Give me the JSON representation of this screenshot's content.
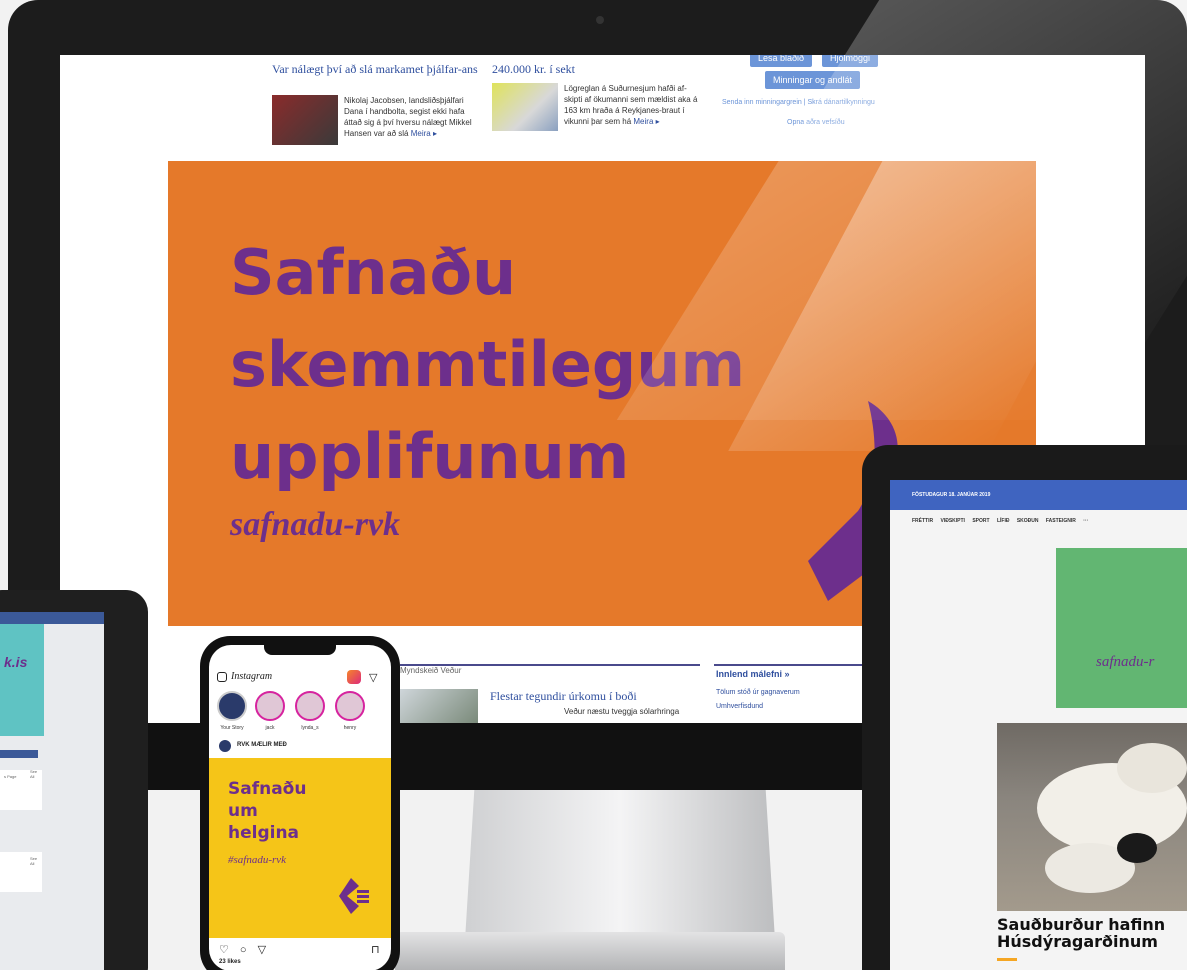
{
  "monitor": {
    "news_left": {
      "headline": "Var nálægt því að slá markamet þjálfar-ans",
      "text": "Nikolaj Jacobsen, landsliðsþjálfari Dana í handbolta, segist ekki hafa áttað sig á því hversu nálægt Mikkel Hansen var að slá",
      "more": "Meira ▸"
    },
    "news_mid": {
      "headline": "240.000 kr. í sekt",
      "text": "Lögreglan á Suðurnesjum hafði af-skipti af ökumanni sem mældist aka á 163 km hraða á Reykjanes-braut í vikunni þar sem há",
      "more": "Meira ▸"
    },
    "side": {
      "btn1": "Lesa blaðið",
      "btn2": "Hjólmöggi",
      "btn3": "Minningar og andlát",
      "line1": "Senda inn minningargrein  |  Skrá dánartilkynningu",
      "line2": "Opna aðra vefsíðu"
    },
    "banner": {
      "heading": "Safnaðu\nskemmtilegum\nupplifunum",
      "tag": "safnadu-rvk"
    },
    "bottom": {
      "tabs": "Myndskeið   Veður",
      "headline": "Flestar tegundir úrkomu í boði",
      "text": "Veður næstu tveggja sólarhringa",
      "innlend_title": "Innlend málefni »",
      "innlend_items": [
        "Tölum stóð úr gagnaverum",
        "Umhverfisdund"
      ]
    }
  },
  "tablet_left": {
    "domain": "k.is",
    "see_all_1": "See All",
    "see_all_2": "See All",
    "page_label": "s Page"
  },
  "phone": {
    "app_name": "Instagram",
    "stories": [
      "Your Story",
      "jack",
      "lynda_s",
      "henry"
    ],
    "post_user": "RVK MÆLIR MEÐ",
    "post_heading": "Safnaðu\num\nhelgina",
    "post_tag": "#safnadu-rvk",
    "actions": "♡ ○ ▽",
    "bookmark": "⊓",
    "likes": "23 likes"
  },
  "tablet_right": {
    "date": "FÖSTUDAGUR 18. JANÚAR 2019",
    "nav": "FRÉTTIR   VIÐSKIPTI   SPORT   LÍFIÐ   SKOÐUN   FASTEIGNIR   ···",
    "green_tag": "safnadu-r",
    "headline": "Sauðburður hafinn\nHúsdýragarðinum"
  },
  "colors": {
    "orange": "#e5792a",
    "purple": "#6d2f8c",
    "yellow": "#f5c518",
    "green": "#62b672",
    "link_blue": "#2f4f9e"
  }
}
